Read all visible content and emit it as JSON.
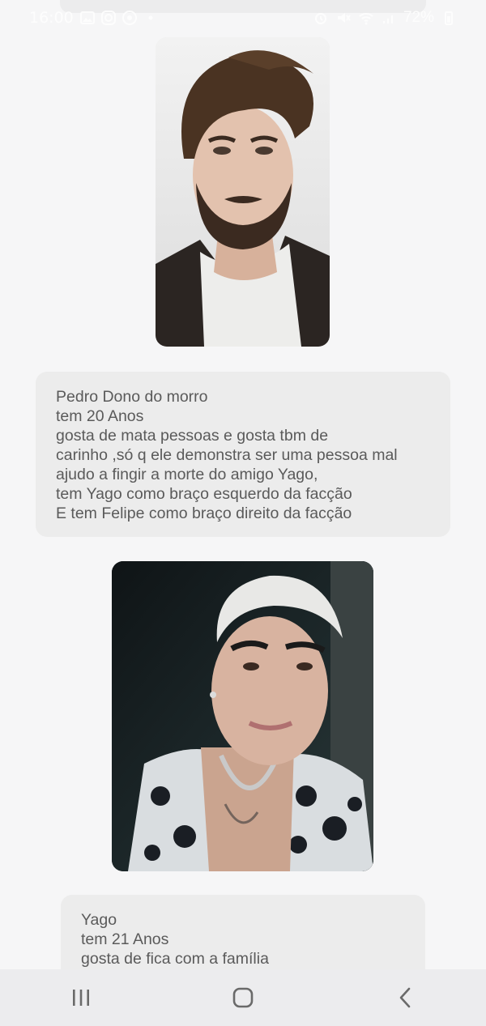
{
  "status_bar": {
    "time": "16:00",
    "battery": "72%"
  },
  "cards": [
    {
      "photo_label": "Pedro",
      "lines": [
        "Pedro Dono do morro",
        "tem 20 Anos",
        "gosta de mata  pessoas e gosta tbm de",
        "carinho ,só q ele demonstra ser uma pessoa mal",
        "ajudo a fingir a morte do amigo Yago,",
        "tem Yago como braço esquerdo da facção",
        "E tem Felipe como braço direito da facção"
      ]
    },
    {
      "photo_label": "Yago",
      "lines": [
        "Yago",
        "tem 21 Anos",
        "gosta de fica com a família"
      ]
    }
  ],
  "nav": {
    "recents_icon": "recents-icon",
    "home_icon": "home-icon",
    "back_icon": "back-icon"
  },
  "colors": {
    "background": "#f6f6f7",
    "card": "#ececec",
    "text": "#5a5a5a",
    "navbar": "#ececee"
  }
}
